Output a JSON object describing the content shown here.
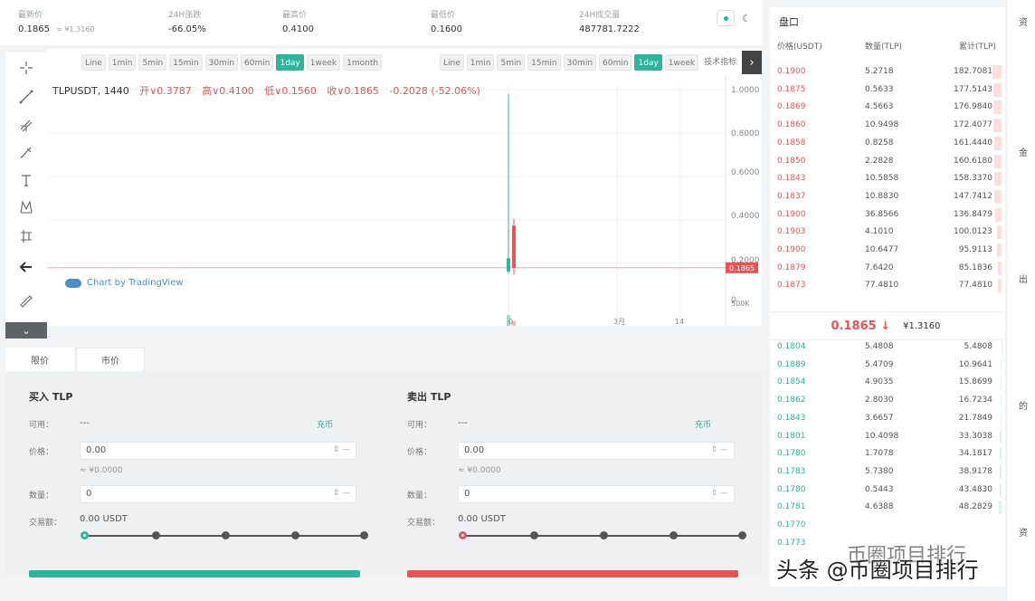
{
  "stats": [
    {
      "label": "最新价",
      "value": "0.1865",
      "sub": "≈ ¥1.3160",
      "color": "#e85454"
    },
    {
      "label": "24H涨跌",
      "value": "-66.05%",
      "sub": "",
      "color": "#e85454"
    },
    {
      "label": "最高价",
      "value": "0.4100",
      "sub": "",
      "color": "#333333"
    },
    {
      "label": "最低价",
      "value": "0.1600",
      "sub": "",
      "color": "#333333"
    },
    {
      "label": "24H成交量",
      "value": "487781.7222",
      "sub": "",
      "color": "#333333"
    }
  ],
  "toolbar": {
    "interval_left": [
      "Line",
      "1min",
      "5min",
      "15min",
      "30min",
      "60min",
      "1day",
      "1week",
      "1month"
    ],
    "interval_right": [
      "Line",
      "1min",
      "5min",
      "15min",
      "30min",
      "60min",
      "1day",
      "1week"
    ],
    "active_left": "1day",
    "active_right": "1day",
    "right_tail": "技术指标"
  },
  "legend": {
    "symbol": "TLPUSDT, 1440",
    "open": "开∨0.3787",
    "high": "高∨0.4100",
    "low": "低∨0.1560",
    "close": "收∨0.1865",
    "change": "-0.2028 (-52.06%)"
  },
  "branding": "Chart by TradingView",
  "chart_data": {
    "type": "candlestick",
    "y_ticks": [
      "1.0000",
      "0.8000",
      "0.6000",
      "0.4000",
      "0.2000",
      "0"
    ],
    "volume_tick": "500K",
    "x_ticks": [
      "0",
      "3月",
      "14"
    ],
    "last_price_label": "0.1865",
    "ylim": [
      0,
      1.0
    ],
    "candles": [
      {
        "open": 0.17,
        "high": 0.98,
        "low": 0.16,
        "close": 0.23,
        "color": "#2bb59a"
      },
      {
        "open": 0.3787,
        "high": 0.41,
        "low": 0.156,
        "close": 0.1865,
        "color": "#e85454"
      }
    ],
    "volumes": [
      0.6,
      0.38
    ]
  },
  "order_form": {
    "tabs": [
      "限价",
      "市价"
    ],
    "buy": {
      "title": "买入 TLP",
      "avail_label": "可用：",
      "avail_value": "---",
      "recharge": "充币",
      "price_label": "价格：",
      "price_value": "0.00",
      "price_hint": "≈ ¥0.0000",
      "amount_label": "数量：",
      "amount_value": "0",
      "total_label": "交易额：",
      "total_value": "0.00 USDT"
    },
    "sell": {
      "title": "卖出 TLP",
      "avail_label": "可用：",
      "avail_value": "---",
      "recharge": "充币",
      "price_label": "价格：",
      "price_value": "0.00",
      "price_hint": "≈ ¥0.0000",
      "amount_label": "数量：",
      "amount_value": "0",
      "total_label": "交易额：",
      "total_value": "0.00 USDT"
    }
  },
  "order_book": {
    "title": "盘口",
    "headers": [
      "价格(USDT)",
      "数量(TLP)",
      "累计(TLP)"
    ],
    "asks": [
      {
        "price": "0.1900",
        "qty": "5.2718",
        "total": "182.7081"
      },
      {
        "price": "0.1875",
        "qty": "0.5633",
        "total": "177.5143"
      },
      {
        "price": "0.1869",
        "qty": "4.5663",
        "total": "176.9840"
      },
      {
        "price": "0.1860",
        "qty": "10.9498",
        "total": "172.4077"
      },
      {
        "price": "0.1858",
        "qty": "0.8258",
        "total": "161.4440"
      },
      {
        "price": "0.1850",
        "qty": "2.2828",
        "total": "160.6180"
      },
      {
        "price": "0.1843",
        "qty": "10.5858",
        "total": "158.3370"
      },
      {
        "price": "0.1837",
        "qty": "10.8830",
        "total": "147.7412"
      },
      {
        "price": "0.1900",
        "qty": "36.8566",
        "total": "136.8479"
      },
      {
        "price": "0.1903",
        "qty": "4.1010",
        "total": "100.0123"
      },
      {
        "price": "0.1900",
        "qty": "10.6477",
        "total": "95.9113"
      },
      {
        "price": "0.1879",
        "qty": "7.6420",
        "total": "85.1836"
      },
      {
        "price": "0.1873",
        "qty": "77.4810",
        "total": "77.4810"
      }
    ],
    "last_price": "0.1865 ↓",
    "last_cny": "¥1.3160",
    "bids": [
      {
        "price": "0.1804",
        "qty": "5.4808",
        "total": "5.4808"
      },
      {
        "price": "0.1889",
        "qty": "5.4709",
        "total": "10.9641"
      },
      {
        "price": "0.1854",
        "qty": "4.9035",
        "total": "15.8699"
      },
      {
        "price": "0.1862",
        "qty": "2.8030",
        "total": "16.7234"
      },
      {
        "price": "0.1843",
        "qty": "3.6657",
        "total": "21.7849"
      },
      {
        "price": "0.1801",
        "qty": "10.4098",
        "total": "33.3038"
      },
      {
        "price": "0.1780",
        "qty": "1.7078",
        "total": "34.1817"
      },
      {
        "price": "0.1783",
        "qty": "5.7380",
        "total": "38.9178"
      },
      {
        "price": "0.1780",
        "qty": "0.5443",
        "total": "43.4830"
      },
      {
        "price": "0.1781",
        "qty": "4.6388",
        "total": "48.2829"
      },
      {
        "price": "0.1770",
        "qty": "",
        "total": ""
      },
      {
        "price": "0.1773",
        "qty": "",
        "total": ""
      }
    ]
  },
  "right_edge": [
    "资",
    "金",
    "出",
    "的",
    "资"
  ],
  "watermark": "头条 @币圈项目排行",
  "watermark_ghost": "币圈项目排行",
  "icons": [
    "crosshair-icon",
    "trend-line-icon",
    "fib-icon",
    "brush-icon",
    "text-icon",
    "pattern-icon",
    "measure-icon",
    "back-arrow-icon",
    "ruler-icon",
    "chevron-down-icon",
    "chevron-right-icon",
    "moon-icon"
  ]
}
